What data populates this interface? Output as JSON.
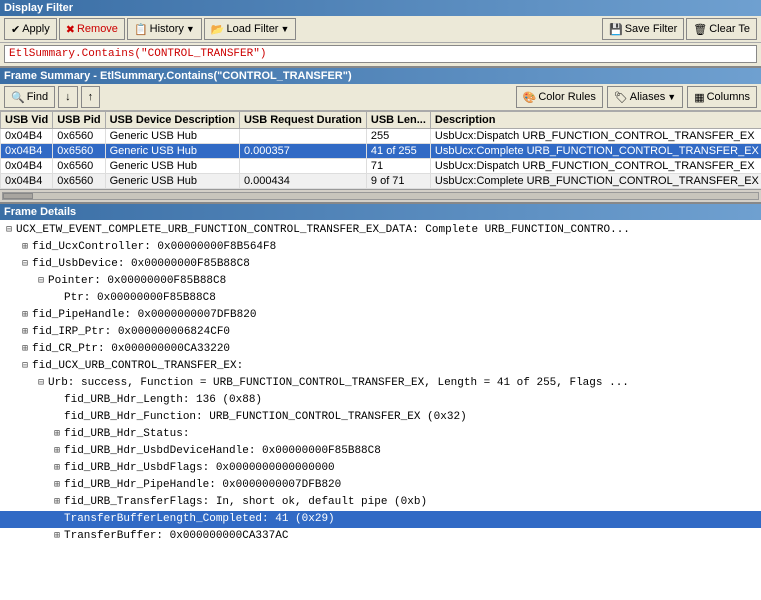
{
  "displayFilter": {
    "title": "Display Filter",
    "toolbar": {
      "apply": "Apply",
      "remove": "Remove",
      "history": "History",
      "loadFilter": "Load Filter",
      "saveFilter": "Save Filter",
      "clear": "Clear Te"
    },
    "filterText": "EtlSummary.Contains(\"CONTROL_TRANSFER\")"
  },
  "frameSummary": {
    "title": "Frame Summary - EtlSummary.Contains(\"CONTROL_TRANSFER\")",
    "toolbar": {
      "find": "Find",
      "colorRules": "Color Rules",
      "aliases": "Aliases",
      "columns": "Columns"
    },
    "columns": [
      "USB Vid",
      "USB Pid",
      "USB Device Description",
      "USB Request Duration",
      "USB Len...",
      "Description"
    ],
    "rows": [
      {
        "usbVid": "0x04B4",
        "usbPid": "0x6560",
        "deviceDesc": "Generic USB Hub",
        "requestDuration": "",
        "usbLen": "255",
        "description": "UsbUcx:Dispatch URB_FUNCTION_CONTROL_TRANSFER_EX"
      },
      {
        "usbVid": "0x04B4",
        "usbPid": "0x6560",
        "deviceDesc": "Generic USB Hub",
        "requestDuration": "0.000357",
        "usbLen": "41 of 255",
        "description": "UsbUcx:Complete URB_FUNCTION_CONTROL_TRANSFER_EX with data"
      },
      {
        "usbVid": "0x04B4",
        "usbPid": "0x6560",
        "deviceDesc": "Generic USB Hub",
        "requestDuration": "",
        "usbLen": "71",
        "description": "UsbUcx:Dispatch URB_FUNCTION_CONTROL_TRANSFER_EX"
      },
      {
        "usbVid": "0x04B4",
        "usbPid": "0x6560",
        "deviceDesc": "Generic USB Hub",
        "requestDuration": "0.000434",
        "usbLen": "9 of 71",
        "description": "UsbUcx:Complete URB_FUNCTION_CONTROL_TRANSFER_EX with data"
      }
    ]
  },
  "frameDetails": {
    "title": "Frame Details",
    "treeItems": [
      {
        "level": 0,
        "expanded": true,
        "expander": "⊟",
        "text": "UCX_ETW_EVENT_COMPLETE_URB_FUNCTION_CONTROL_TRANSFER_EX_DATA: Complete URB_FUNCTION_CONTRO...",
        "highlighted": false
      },
      {
        "level": 1,
        "expanded": true,
        "expander": "⊞",
        "text": "fid_UcxController: 0x00000000F8B564F8",
        "highlighted": false
      },
      {
        "level": 1,
        "expanded": true,
        "expander": "⊟",
        "text": "fid_UsbDevice: 0x00000000F85B88C8",
        "highlighted": false
      },
      {
        "level": 2,
        "expanded": true,
        "expander": "⊟",
        "text": "Pointer: 0x00000000F85B88C8",
        "highlighted": false
      },
      {
        "level": 3,
        "expanded": false,
        "expander": "",
        "text": "Ptr: 0x00000000F85B88C8",
        "highlighted": false
      },
      {
        "level": 1,
        "expanded": true,
        "expander": "⊞",
        "text": "fid_PipeHandle: 0x0000000007DFB820",
        "highlighted": false
      },
      {
        "level": 1,
        "expanded": true,
        "expander": "⊞",
        "text": "fid_IRP_Ptr: 0x000000006824CF0",
        "highlighted": false
      },
      {
        "level": 1,
        "expanded": true,
        "expander": "⊞",
        "text": "fid_CR_Ptr: 0x000000000CA33220",
        "highlighted": false
      },
      {
        "level": 1,
        "expanded": true,
        "expander": "⊟",
        "text": "fid_UCX_URB_CONTROL_TRANSFER_EX:",
        "highlighted": false
      },
      {
        "level": 2,
        "expanded": true,
        "expander": "⊟",
        "text": "Urb: success, Function = URB_FUNCTION_CONTROL_TRANSFER_EX, Length = 41 of 255, Flags ...",
        "highlighted": false
      },
      {
        "level": 3,
        "expanded": false,
        "expander": "",
        "text": "fid_URB_Hdr_Length: 136 (0x88)",
        "highlighted": false
      },
      {
        "level": 3,
        "expanded": false,
        "expander": "",
        "text": "fid_URB_Hdr_Function: URB_FUNCTION_CONTROL_TRANSFER_EX (0x32)",
        "highlighted": false
      },
      {
        "level": 3,
        "expanded": true,
        "expander": "⊞",
        "text": "fid_URB_Hdr_Status:",
        "highlighted": false
      },
      {
        "level": 3,
        "expanded": true,
        "expander": "⊞",
        "text": "fid_URB_Hdr_UsbdDeviceHandle: 0x00000000F85B88C8",
        "highlighted": false
      },
      {
        "level": 3,
        "expanded": true,
        "expander": "⊞",
        "text": "fid_URB_Hdr_UsbdFlags: 0x0000000000000000",
        "highlighted": false
      },
      {
        "level": 3,
        "expanded": true,
        "expander": "⊞",
        "text": "fid_URB_Hdr_PipeHandle: 0x0000000007DFB820",
        "highlighted": false
      },
      {
        "level": 3,
        "expanded": true,
        "expander": "⊞",
        "text": "fid_URB_TransferFlags: In, short ok, default pipe (0xb)",
        "highlighted": false
      },
      {
        "level": 3,
        "expanded": false,
        "expander": "",
        "text": "TransferBufferLength_Completed: 41 (0x29)",
        "highlighted": true
      },
      {
        "level": 3,
        "expanded": true,
        "expander": "⊞",
        "text": "TransferBuffer: 0x000000000CA337AC",
        "highlighted": false
      }
    ]
  }
}
